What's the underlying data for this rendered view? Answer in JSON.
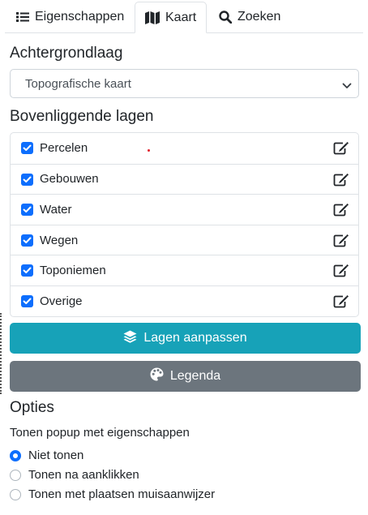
{
  "tabs": [
    {
      "label": "Eigenschappen",
      "icon": "list-icon",
      "active": false
    },
    {
      "label": "Kaart",
      "icon": "map-icon",
      "active": true
    },
    {
      "label": "Zoeken",
      "icon": "search-icon",
      "active": false
    }
  ],
  "background_section": {
    "heading": "Achtergrondlaag",
    "selected": "Topografische kaart"
  },
  "overlay_section": {
    "heading": "Bovenliggende lagen",
    "layers": [
      {
        "label": "Percelen",
        "checked": true
      },
      {
        "label": "Gebouwen",
        "checked": true
      },
      {
        "label": "Water",
        "checked": true
      },
      {
        "label": "Wegen",
        "checked": true
      },
      {
        "label": "Toponiemen",
        "checked": true
      },
      {
        "label": "Overige",
        "checked": true
      }
    ]
  },
  "buttons": {
    "adjust_layers": "Lagen aanpassen",
    "legend": "Legenda"
  },
  "options": {
    "heading": "Opties",
    "popup_label": "Tonen popup met eigenschappen",
    "radios": [
      {
        "label": "Niet tonen",
        "checked": true
      },
      {
        "label": "Tonen na aanklikken",
        "checked": false
      },
      {
        "label": "Tonen met plaatsen muisaanwijzer",
        "checked": false
      }
    ]
  },
  "colors": {
    "primary": "#0d6efd",
    "info": "#17a2b8",
    "secondary": "#6c757d"
  }
}
